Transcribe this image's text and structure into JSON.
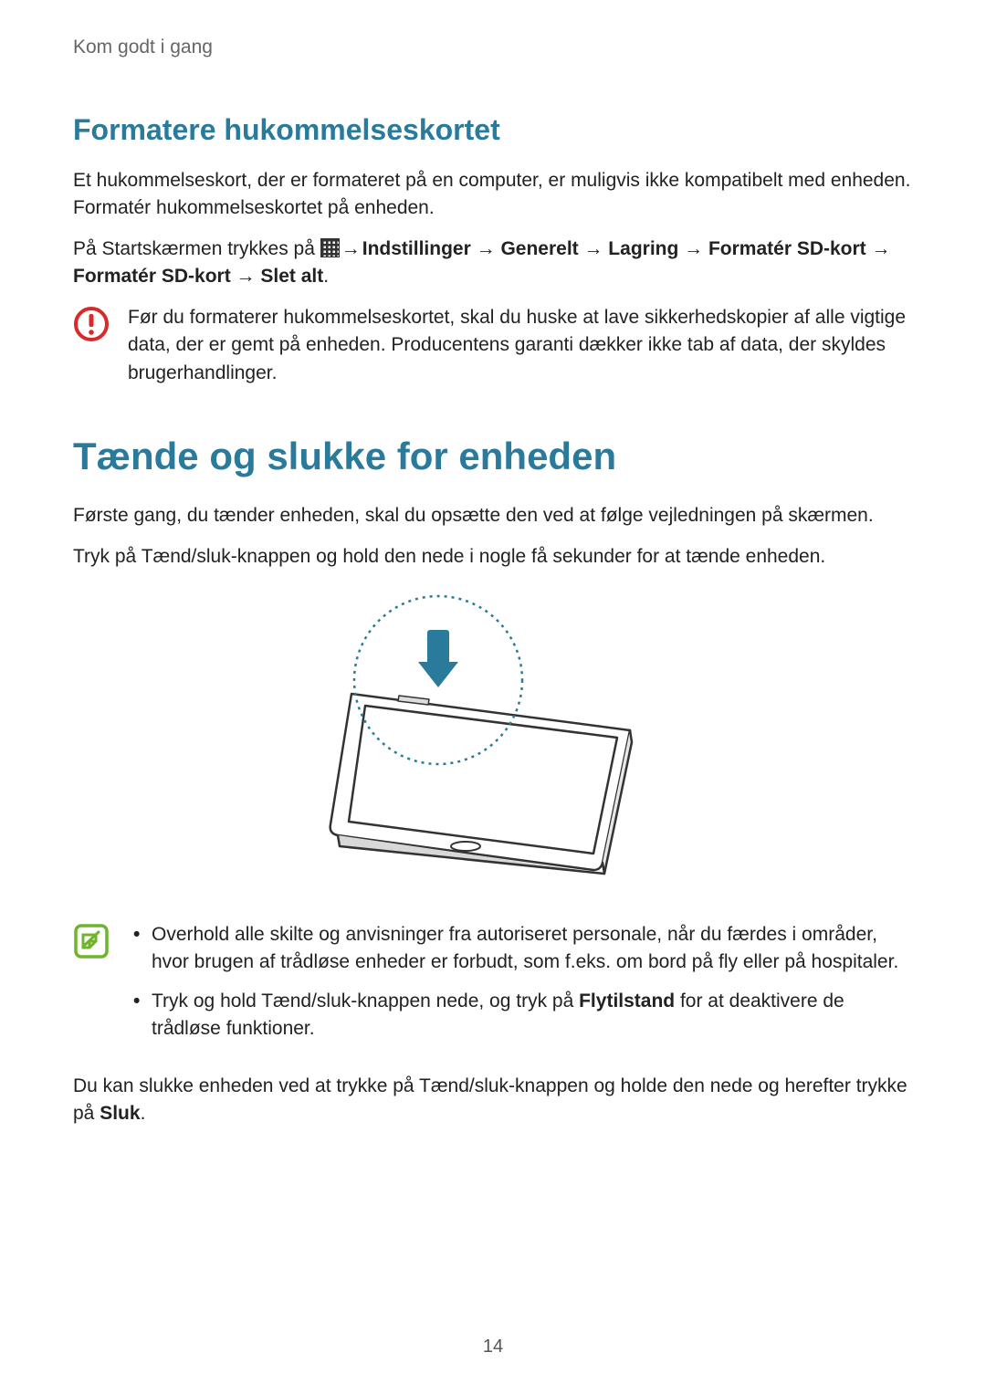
{
  "header": {
    "chapter": "Kom godt i gang"
  },
  "sec1": {
    "title": "Formatere hukommelseskortet",
    "p1": "Et hukommelseskort, der er formateret på en computer, er muligvis ikke kompatibelt med enheden. Formatér hukommelseskortet på enheden.",
    "p2_prefix": "På Startskærmen trykkes på ",
    "p2_bold": "Indstillinger → Generelt → Lagring → Formatér SD-kort → Formatér SD-kort → Slet alt",
    "p2_suffix": ".",
    "warn": "Før du formaterer hukommelseskortet, skal du huske at lave sikkerhedskopier af alle vigtige data, der er gemt på enheden. Producentens garanti dækker ikke tab af data, der skyldes brugerhandlinger."
  },
  "sec2": {
    "title": "Tænde og slukke for enheden",
    "p1": "Første gang, du tænder enheden, skal du opsætte den ved at følge vejledningen på skærmen.",
    "p2": "Tryk på Tænd/sluk-knappen og hold den nede i nogle få sekunder for at tænde enheden.",
    "tip1": "Overhold alle skilte og anvisninger fra autoriseret personale, når du færdes i områder, hvor brugen af trådløse enheder er forbudt, som f.eks. om bord på fly eller på hospitaler.",
    "tip2_a": "Tryk og hold Tænd/sluk-knappen nede, og tryk på ",
    "tip2_b": "Flytilstand",
    "tip2_c": " for at deaktivere de trådløse funktioner.",
    "p3_a": "Du kan slukke enheden ved at trykke på Tænd/sluk-knappen og holde den nede og herefter trykke på ",
    "p3_b": "Sluk",
    "p3_c": "."
  },
  "page_number": "14"
}
